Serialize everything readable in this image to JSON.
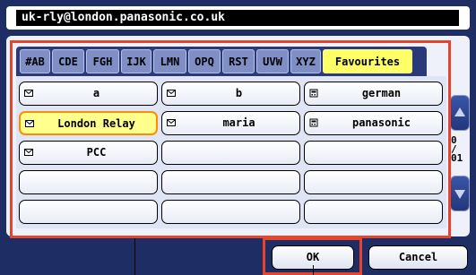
{
  "address_field": {
    "value": "uk-rly@london.panasonic.co.uk"
  },
  "tabs": [
    {
      "label": "#AB"
    },
    {
      "label": "CDE"
    },
    {
      "label": "FGH"
    },
    {
      "label": "IJK"
    },
    {
      "label": "LMN"
    },
    {
      "label": "OPQ"
    },
    {
      "label": "RST"
    },
    {
      "label": "UVW"
    },
    {
      "label": "XYZ"
    },
    {
      "label": "Favourites"
    }
  ],
  "active_tab": "Favourites",
  "entries": [
    {
      "label": "a",
      "icon": "email-icon"
    },
    {
      "label": "b",
      "icon": "email-icon"
    },
    {
      "label": "german",
      "icon": "fax-icon"
    },
    {
      "label": "London Relay",
      "icon": "email-icon",
      "selected": true
    },
    {
      "label": "maria",
      "icon": "email-icon"
    },
    {
      "label": "panasonic",
      "icon": "fax-icon"
    },
    {
      "label": "PCC",
      "icon": "email-icon"
    }
  ],
  "page_indicator": {
    "current": "0",
    "sep": "/",
    "total": "01"
  },
  "buttons": {
    "ok": "OK",
    "cancel": "Cancel"
  },
  "colors": {
    "panel": "#1e2d63",
    "highlight": "#e8432d",
    "active_tab": "#ffff66",
    "selected_entry": "#ffff8e"
  }
}
